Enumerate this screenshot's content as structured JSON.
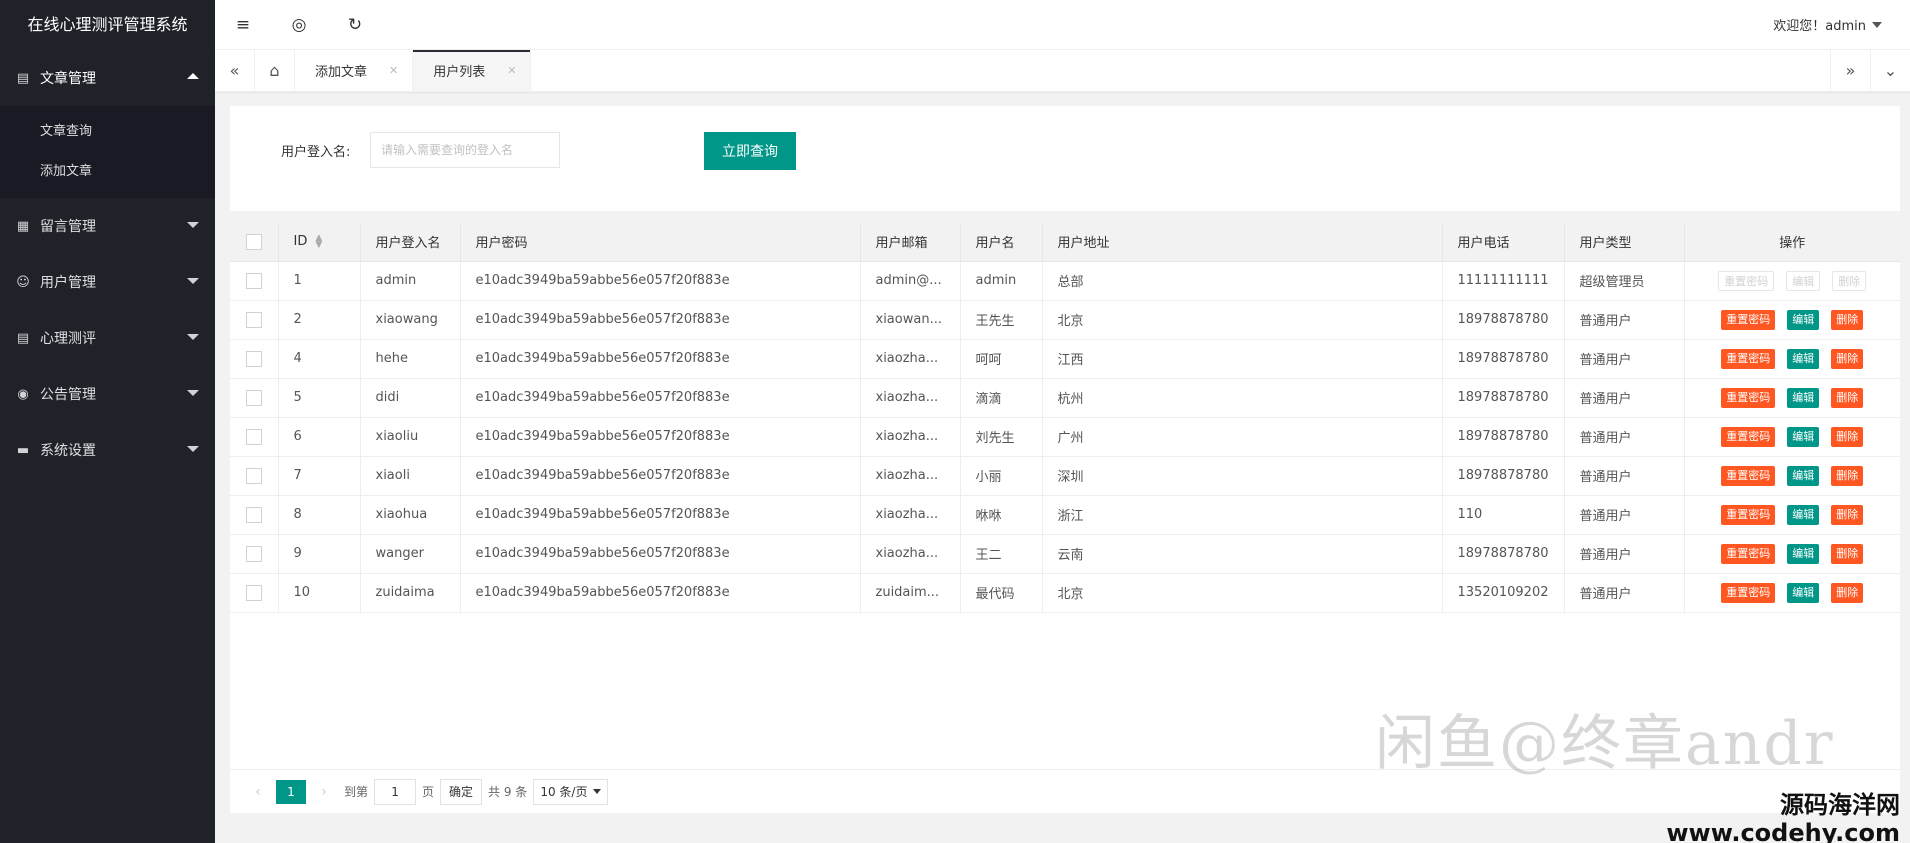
{
  "app": {
    "title": "在线心理测评管理系统"
  },
  "sidebar": {
    "groups": [
      {
        "label": "文章管理",
        "icon": "book-icon",
        "open": true,
        "items": [
          {
            "label": "文章查询"
          },
          {
            "label": "添加文章"
          }
        ]
      },
      {
        "label": "留言管理",
        "icon": "message-icon"
      },
      {
        "label": "用户管理",
        "icon": "user-icon"
      },
      {
        "label": "心理测评",
        "icon": "clipboard-icon"
      },
      {
        "label": "公告管理",
        "icon": "announcement-icon"
      },
      {
        "label": "系统设置",
        "icon": "settings-icon"
      }
    ]
  },
  "header": {
    "welcome": "欢迎您！admin"
  },
  "tabs": [
    {
      "label": "添加文章",
      "active": false
    },
    {
      "label": "用户列表",
      "active": true
    }
  ],
  "search": {
    "label": "用户登入名:",
    "placeholder": "请输入需要查询的登入名",
    "button": "立即查询"
  },
  "table": {
    "columns": [
      "ID",
      "用户登入名",
      "用户密码",
      "用户邮箱",
      "用户名",
      "用户地址",
      "用户电话",
      "用户类型",
      "操作"
    ],
    "actions": {
      "reset": "重置密码",
      "edit": "编辑",
      "delete": "删除"
    },
    "rows": [
      {
        "id": "1",
        "login": "admin",
        "pwd": "e10adc3949ba59abbe56e057f20f883e",
        "email": "admin@...",
        "name": "admin",
        "addr": "总部",
        "phone": "11111111111",
        "type": "超级管理员",
        "disabled": true
      },
      {
        "id": "2",
        "login": "xiaowang",
        "pwd": "e10adc3949ba59abbe56e057f20f883e",
        "email": "xiaowan...",
        "name": "王先生",
        "addr": "北京",
        "phone": "18978878780",
        "type": "普通用户"
      },
      {
        "id": "4",
        "login": "hehe",
        "pwd": "e10adc3949ba59abbe56e057f20f883e",
        "email": "xiaozha...",
        "name": "呵呵",
        "addr": "江西",
        "phone": "18978878780",
        "type": "普通用户"
      },
      {
        "id": "5",
        "login": "didi",
        "pwd": "e10adc3949ba59abbe56e057f20f883e",
        "email": "xiaozha...",
        "name": "滴滴",
        "addr": "杭州",
        "phone": "18978878780",
        "type": "普通用户"
      },
      {
        "id": "6",
        "login": "xiaoliu",
        "pwd": "e10adc3949ba59abbe56e057f20f883e",
        "email": "xiaozha...",
        "name": "刘先生",
        "addr": "广州",
        "phone": "18978878780",
        "type": "普通用户"
      },
      {
        "id": "7",
        "login": "xiaoli",
        "pwd": "e10adc3949ba59abbe56e057f20f883e",
        "email": "xiaozha...",
        "name": "小丽",
        "addr": "深圳",
        "phone": "18978878780",
        "type": "普通用户"
      },
      {
        "id": "8",
        "login": "xiaohua",
        "pwd": "e10adc3949ba59abbe56e057f20f883e",
        "email": "xiaozha...",
        "name": "咻咻",
        "addr": "浙江",
        "phone": "110",
        "type": "普通用户"
      },
      {
        "id": "9",
        "login": "wanger",
        "pwd": "e10adc3949ba59abbe56e057f20f883e",
        "email": "xiaozha...",
        "name": "王二",
        "addr": "云南",
        "phone": "18978878780",
        "type": "普通用户"
      },
      {
        "id": "10",
        "login": "zuidaima",
        "pwd": "e10adc3949ba59abbe56e057f20f883e",
        "email": "zuidaim...",
        "name": "最代码",
        "addr": "北京",
        "phone": "13520109202",
        "type": "普通用户"
      }
    ]
  },
  "pager": {
    "current": "1",
    "goto_label": "到第",
    "goto_value": "1",
    "page_label": "页",
    "confirm": "确定",
    "total": "共 9 条",
    "page_size": "10 条/页"
  },
  "watermarks": {
    "main": "闲鱼@终章andr",
    "site": "源码海洋网",
    "url": "www.codehy.com"
  },
  "colors": {
    "sidebar_bg": "#20222a",
    "primary": "#009688",
    "danger": "#ff5722"
  }
}
